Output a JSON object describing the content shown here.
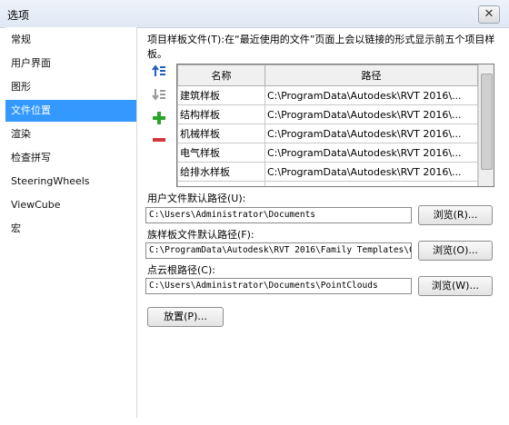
{
  "window": {
    "title": "选项",
    "close_label": "✕"
  },
  "sidebar": {
    "items": [
      {
        "label": "常规",
        "active": false
      },
      {
        "label": "用户界面",
        "active": false
      },
      {
        "label": "图形",
        "active": false
      },
      {
        "label": "文件位置",
        "active": true
      },
      {
        "label": "渲染",
        "active": false
      },
      {
        "label": "检查拼写",
        "active": false
      },
      {
        "label": "SteeringWheels",
        "active": false
      },
      {
        "label": "ViewCube",
        "active": false
      },
      {
        "label": "宏",
        "active": false
      }
    ]
  },
  "templates": {
    "description": "项目样板文件(T):在“最近使用的文件”页面上会以链接的形式显示前五个项目样板。",
    "columns": {
      "name": "名称",
      "path": "路径"
    },
    "rows": [
      {
        "name": "建筑样板",
        "path": "C:\\ProgramData\\Autodesk\\RVT 2016\\..."
      },
      {
        "name": "结构样板",
        "path": "C:\\ProgramData\\Autodesk\\RVT 2016\\..."
      },
      {
        "name": "机械样板",
        "path": "C:\\ProgramData\\Autodesk\\RVT 2016\\..."
      },
      {
        "name": "电气样板",
        "path": "C:\\ProgramData\\Autodesk\\RVT 2016\\..."
      },
      {
        "name": "给排水样板",
        "path": "C:\\ProgramData\\Autodesk\\RVT 2016\\..."
      }
    ],
    "tools": {
      "move_up_icon": "move-up-icon",
      "move_down_icon": "move-down-icon",
      "add_icon": "add-icon",
      "remove_icon": "remove-icon"
    }
  },
  "user_files": {
    "label": "用户文件默认路径(U):",
    "value": "C:\\Users\\Administrator\\Documents",
    "browse_label": "浏览(R)..."
  },
  "family_templates": {
    "label": "族样板文件默认路径(F):",
    "value": "C:\\ProgramData\\Autodesk\\RVT 2016\\Family Templates\\C",
    "browse_label": "浏览(O)..."
  },
  "point_cloud": {
    "label": "点云根路径(C):",
    "value": "C:\\Users\\Administrator\\Documents\\PointClouds",
    "browse_label": "浏览(W)..."
  },
  "places_button_label": "放置(P)...",
  "colors": {
    "selection": "#3399ff",
    "add": "#2aa52a",
    "remove": "#d0383a",
    "arrow": "#1f5fbf"
  }
}
